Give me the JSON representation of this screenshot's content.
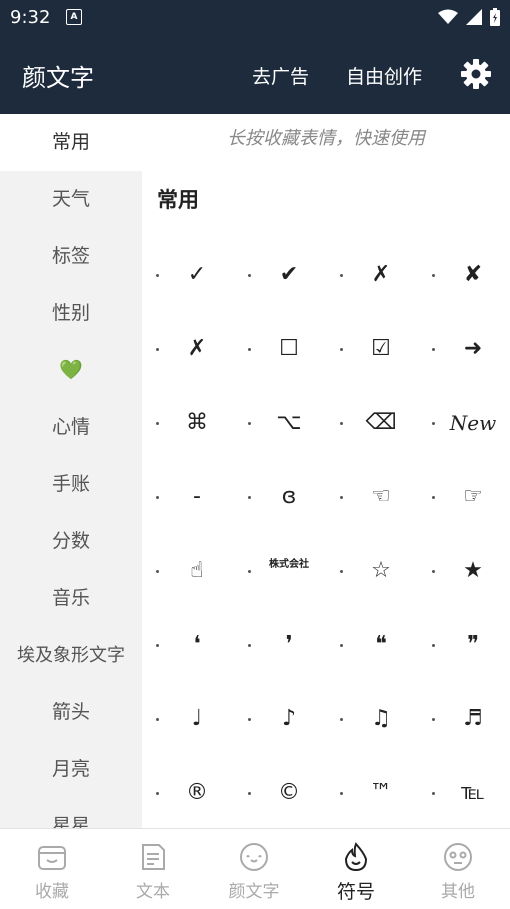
{
  "status": {
    "time": "9:32",
    "notif_letter": "A"
  },
  "app": {
    "title": "颜文字",
    "remove_ads": "去广告",
    "create": "自由创作",
    "settings_icon": "gear-icon"
  },
  "sidebar": {
    "items": [
      "常用",
      "天气",
      "标签",
      "性别",
      "💚",
      "心情",
      "手账",
      "分数",
      "音乐",
      "埃及象形文字",
      "箭头",
      "月亮",
      "星星"
    ]
  },
  "content": {
    "hint": "长按收藏表情，快速使用",
    "section_title": "常用",
    "rows": [
      [
        "✓",
        "✔",
        "✗",
        "✘"
      ],
      [
        "✗",
        "☐",
        "☑",
        "➜"
      ],
      [
        "⌘",
        "⌥",
        "⌫",
        "New"
      ],
      [
        "-",
        "ɞ",
        "☜",
        "☞"
      ],
      [
        "☝",
        "株式会社",
        "☆",
        "★"
      ],
      [
        "❛",
        "❜",
        "❝",
        "❞"
      ],
      [
        "♩",
        "♪",
        "♫",
        "♬"
      ],
      [
        "®",
        "©",
        "™",
        "℡"
      ]
    ]
  },
  "tabs": [
    {
      "label": "收藏",
      "icon": "favorites-box-icon"
    },
    {
      "label": "文本",
      "icon": "text-note-icon"
    },
    {
      "label": "颜文字",
      "icon": "kaomoji-face-icon"
    },
    {
      "label": "符号",
      "icon": "flame-symbol-icon"
    },
    {
      "label": "其他",
      "icon": "other-face-icon"
    }
  ],
  "colors": {
    "header_bg": "#1d2b3d",
    "active_tab": "#222222",
    "inactive_tab": "#aaaaaa"
  }
}
